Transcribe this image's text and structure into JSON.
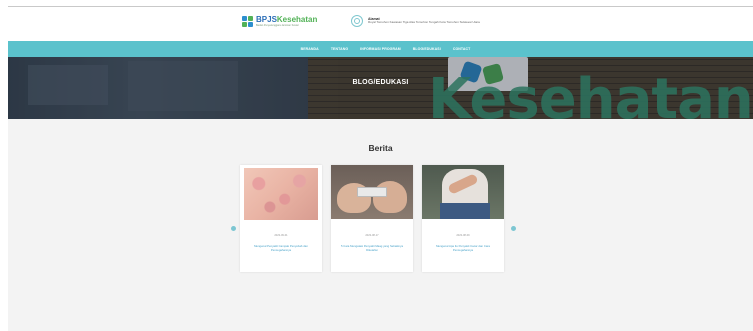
{
  "header": {
    "logo": {
      "name_part1": "BPJS",
      "name_part2": "Kesehatan",
      "tagline": "Badan Penyelenggara Jaminan Sosial"
    },
    "address": {
      "title": "Alamat",
      "text": "Royal Tomohon Kawasan Tiga Alas Tomohon Tengah Kota Tomohon Sulawesi Utara"
    }
  },
  "nav": {
    "items": [
      "BERANDA",
      "TENTANG",
      "INFORMASI PROGRAM",
      "BLOG/EDUKASI",
      "CONTACT"
    ]
  },
  "hero": {
    "title": "BLOG/EDUKASI",
    "background_text": "Kesehatan"
  },
  "main": {
    "section_title": "Berita",
    "cards": [
      {
        "image": "skin-rash-photo",
        "date": "2023-09-01",
        "title": "Mengenal Penyakit Campak Penyebab dan Pencegahannya"
      },
      {
        "image": "pills-in-hands-photo",
        "date": "2023-08-17",
        "title": "5 Cara Mengatasi Penyakit Maag yang Sebaiknya Diketahui"
      },
      {
        "image": "arm-checkup-photo",
        "date": "2023-08-09",
        "title": "Mengenal Apa Itu Penyakit Cacar dan Cara Pencegahannya"
      }
    ]
  },
  "colors": {
    "nav_bg": "#5bc2cc",
    "page_bg": "#f3f3f3",
    "link": "#4aa3c9",
    "brand_blue": "#2d6fb7",
    "brand_green": "#52b257"
  }
}
